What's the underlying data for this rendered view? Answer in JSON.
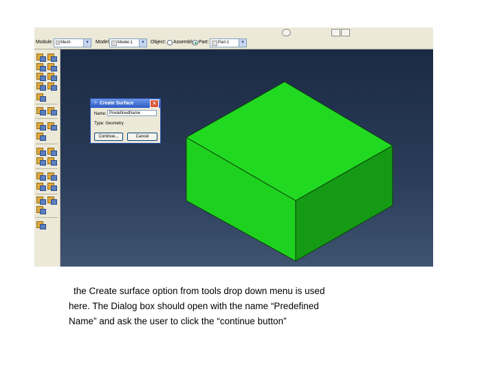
{
  "context_bar": {
    "module_label": "Module:",
    "module_value": "Mesh",
    "model_label": "Model:",
    "model_value": "Model-1",
    "object_label": "Object:",
    "assembly_label": "Assembly",
    "part_label": "Part:",
    "part_value": "Part-1",
    "selected_object": "Part"
  },
  "dialog": {
    "title": "Create Surface",
    "close_glyph": "✕",
    "name_label": "Name:",
    "name_value": "PredefinedName",
    "type_label": "Type:",
    "type_value": "Geometry",
    "continue_label": "Continue...",
    "cancel_label": "Cancel"
  },
  "caption": {
    "line1": "the Create surface option from tools drop down menu is used",
    "line2": "here. The Dialog box should open with the name “Predefined",
    "line3": "Name” and ask the user to click the “continue button”"
  },
  "colors": {
    "box_top": "#22d922",
    "box_left": "#1ed11e",
    "box_right": "#149a14",
    "viewport_top": "#1b2a44",
    "viewport_bottom": "#3f5470",
    "dialog_title": "#2b5ac7"
  },
  "icons": {
    "combo_arrow": "chevron-down-icon",
    "dialog_title_icon": "surface-icon",
    "dialog_close": "close-icon"
  }
}
